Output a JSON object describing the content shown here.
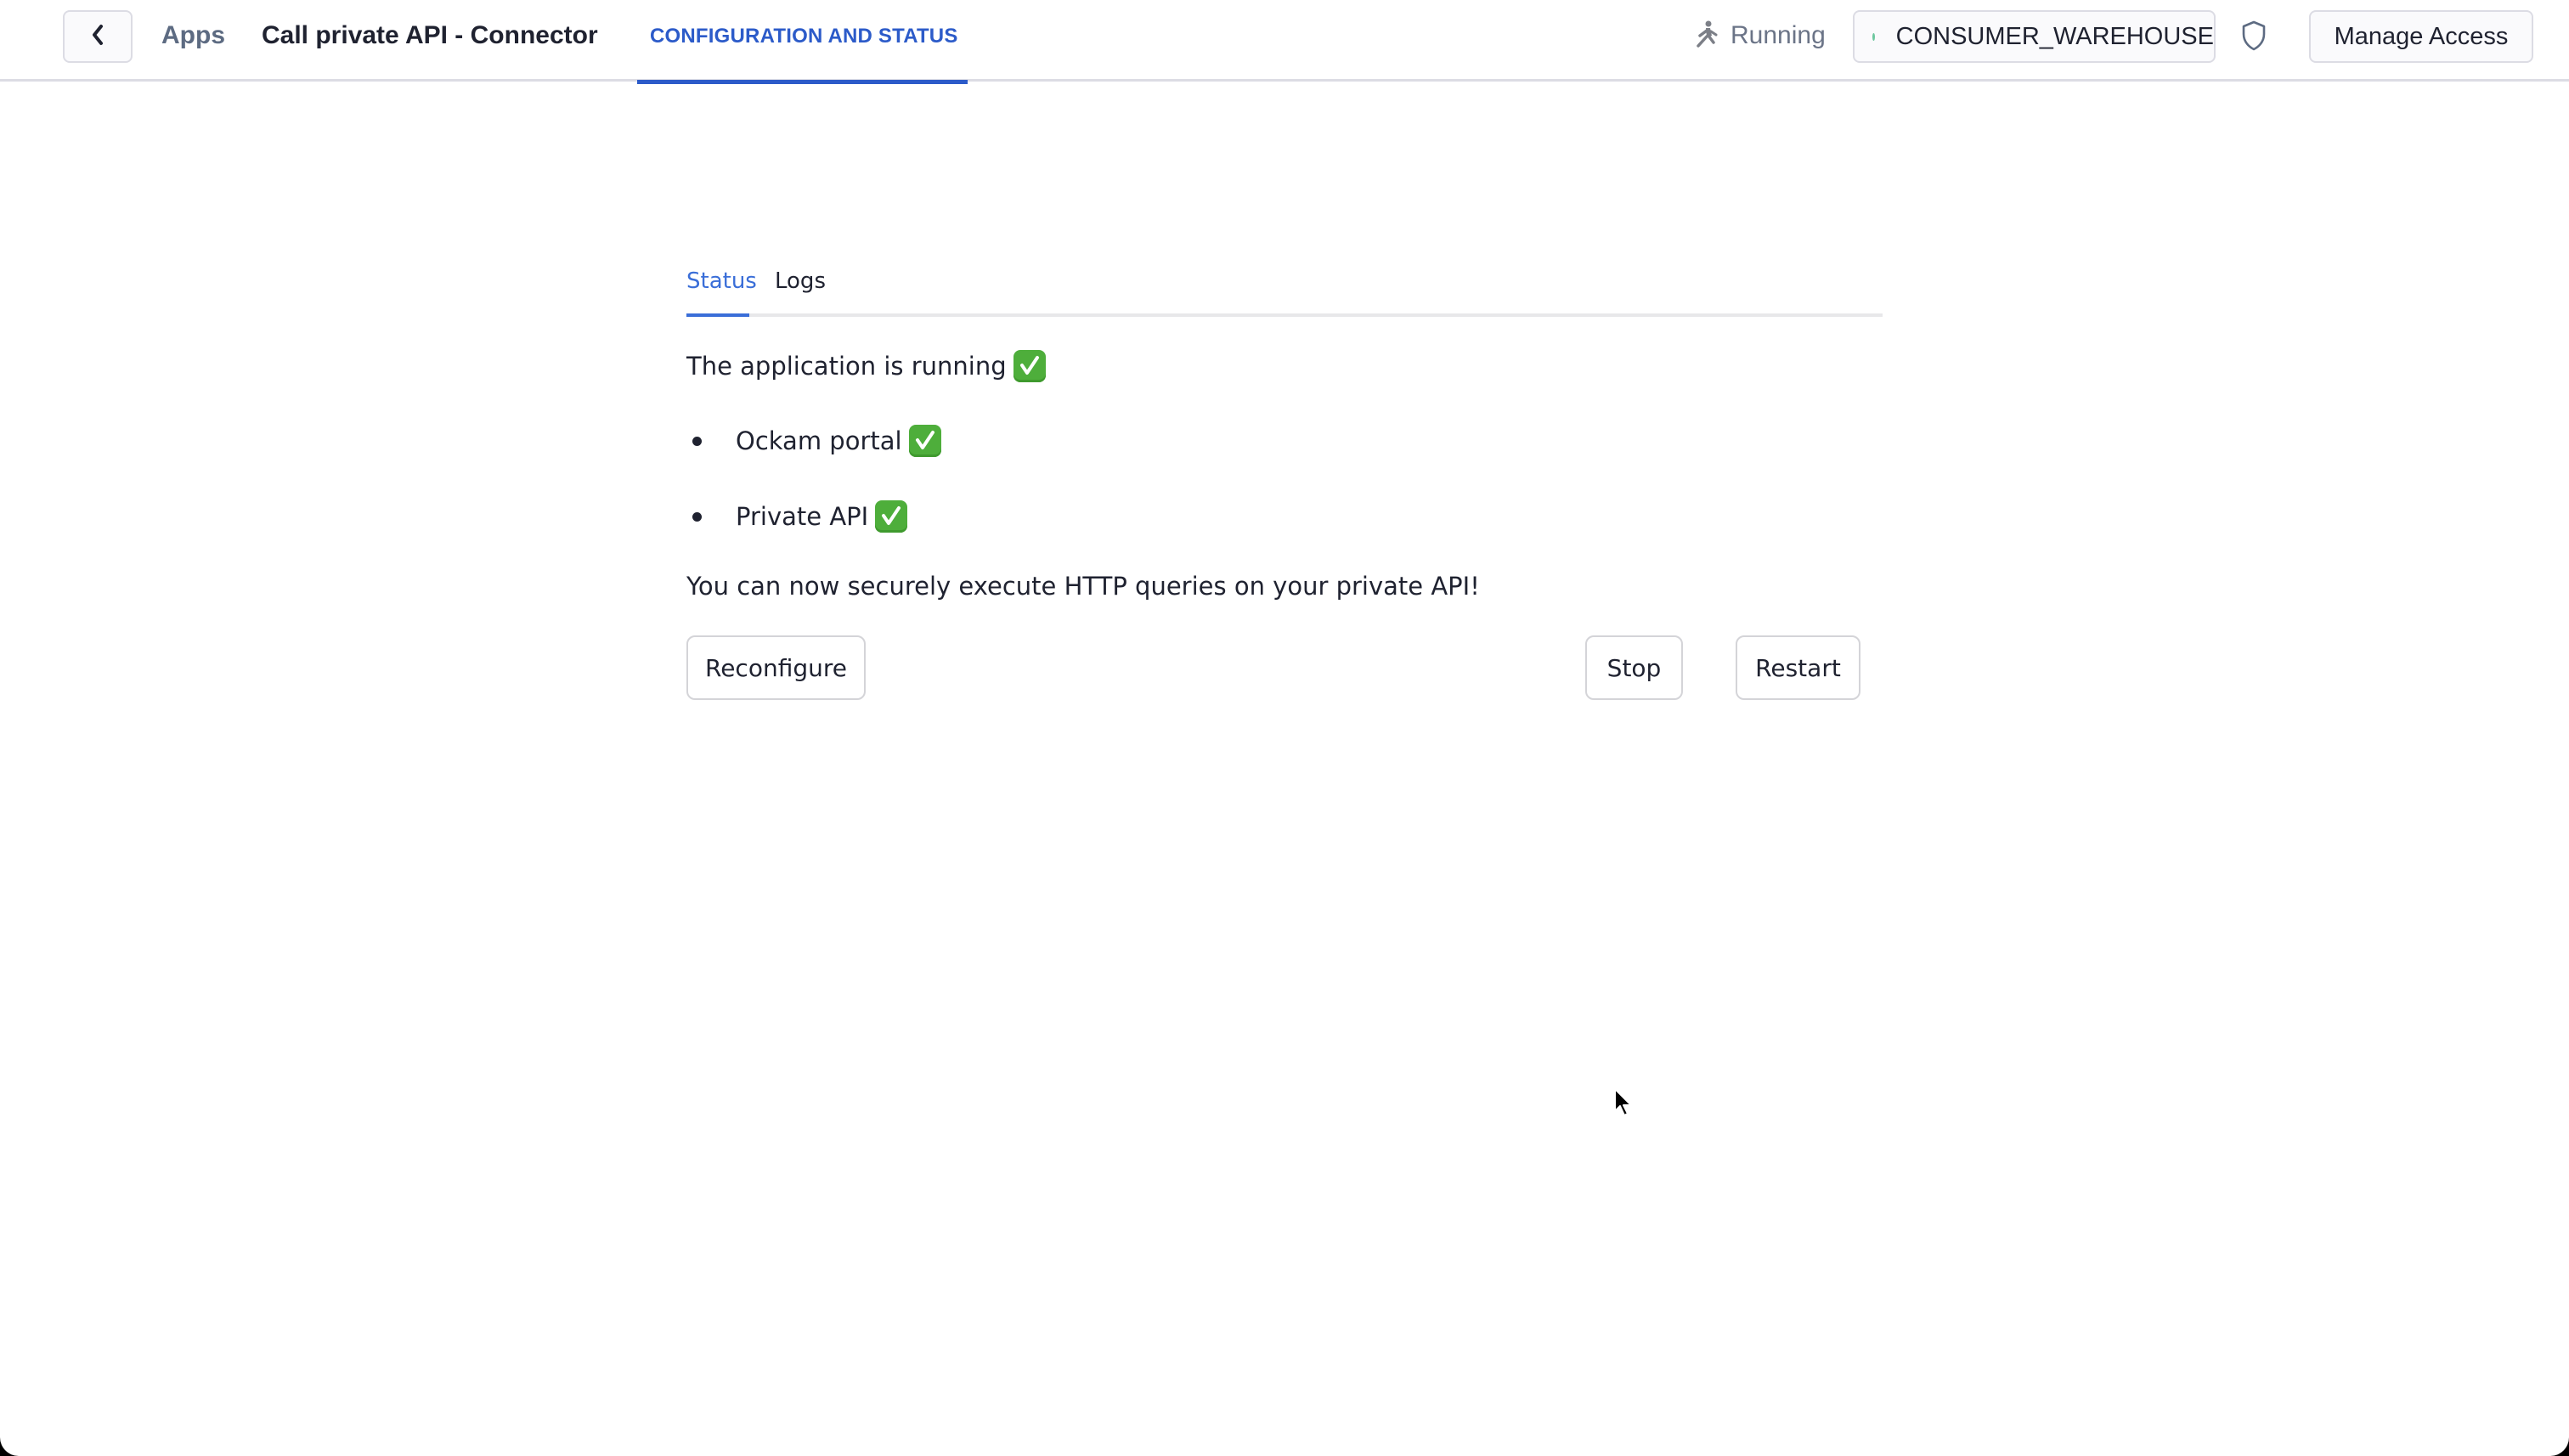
{
  "header": {
    "back_icon": "chevron-left-icon",
    "breadcrumb_apps": "Apps",
    "title": "Call private API - Connector",
    "tabs": [
      {
        "label": "CONFIGURATION AND STATUS",
        "active": true
      }
    ],
    "status": {
      "icon": "running-person-icon",
      "label": "Running"
    },
    "warehouse": {
      "label": "CONSUMER_WAREHOUSE",
      "dot_color": "#6cc79e"
    },
    "shield_icon": "shield-icon",
    "manage_access_label": "Manage Access"
  },
  "main": {
    "subtabs": [
      {
        "label": "Status",
        "active": true
      },
      {
        "label": "Logs",
        "active": false
      }
    ],
    "status_heading": "The application is running",
    "components": [
      {
        "label": "Ockam portal",
        "status": "ok"
      },
      {
        "label": "Private API",
        "status": "ok"
      }
    ],
    "message": "You can now securely execute HTTP queries on your private API!",
    "buttons": {
      "reconfigure": "Reconfigure",
      "stop": "Stop",
      "restart": "Restart"
    }
  },
  "colors": {
    "accent": "#2c5bc9",
    "subtab_accent": "#3a6ed8",
    "check_green": "#4eae3b"
  }
}
